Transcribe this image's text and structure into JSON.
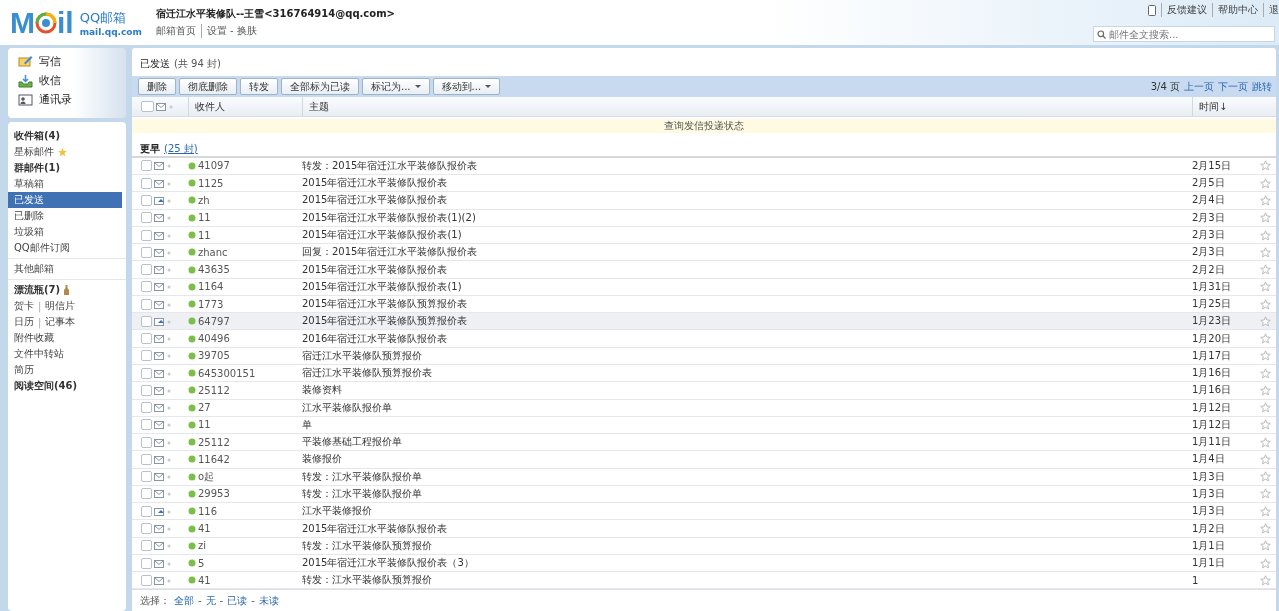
{
  "header": {
    "logo": {
      "left": "M",
      "right": "il",
      "brand": "QQ邮箱",
      "domain": "mail.qq.com"
    },
    "account": "宿迁江水平装修队--王雪<316764914@qq.com>",
    "account_links": [
      "邮箱首页",
      "设置 - 换肤"
    ],
    "top_links": [
      "反馈建议",
      "帮助中心",
      "退"
    ],
    "search": {
      "placeholder": "邮件全文搜索..."
    }
  },
  "actions": [
    {
      "label": "写信",
      "kind": "compose"
    },
    {
      "label": "收信",
      "kind": "inbox"
    },
    {
      "label": "通讯录",
      "kind": "contacts"
    }
  ],
  "folder_groups": [
    [
      {
        "label": "收件箱(4)",
        "bold": true,
        "selected": false
      },
      {
        "label": "星标邮件",
        "bold": false,
        "selected": false,
        "kind": "star"
      },
      {
        "label": "群邮件(1)",
        "bold": true,
        "selected": false
      },
      {
        "label": "草稿箱",
        "bold": false,
        "selected": false
      },
      {
        "label": "已发送",
        "bold": false,
        "selected": true
      },
      {
        "label": "已删除",
        "bold": false,
        "selected": false
      },
      {
        "label": "垃圾箱",
        "bold": false,
        "selected": false
      },
      {
        "label": "QQ邮件订阅",
        "bold": false,
        "selected": false
      }
    ],
    [
      {
        "label": "其他邮箱",
        "bold": false,
        "selected": false
      }
    ],
    [
      {
        "label": "漂流瓶(7)",
        "bold": true,
        "selected": false,
        "kind": "bottle"
      },
      {
        "labels": [
          "贺卡",
          "明信片"
        ],
        "separator": "|",
        "bold": false,
        "selected": false
      },
      {
        "labels": [
          "日历",
          "记事本"
        ],
        "separator": "|",
        "bold": false,
        "selected": false
      },
      {
        "label": "附件收藏",
        "bold": false,
        "selected": false
      },
      {
        "label": "文件中转站",
        "bold": false,
        "selected": false
      },
      {
        "label": "简历",
        "bold": false,
        "selected": false
      },
      {
        "label": "阅读空间(46)",
        "bold": true,
        "selected": false
      }
    ]
  ],
  "mailbox": {
    "title": "已发送",
    "count": "(共 94 封)",
    "toolbar": [
      {
        "label": "删除",
        "dropdown": false
      },
      {
        "label": "彻底删除",
        "dropdown": false
      },
      {
        "label": "转发",
        "dropdown": false
      },
      {
        "label": "全部标为已读",
        "dropdown": false
      },
      {
        "label": "标记为...",
        "dropdown": true
      },
      {
        "label": "移动到...",
        "dropdown": true
      }
    ],
    "pager": {
      "page": "3/4 页",
      "links": [
        "上一页",
        "下一页",
        "跳转"
      ]
    },
    "select_all": {
      "checked": false
    },
    "columns": [
      "收件人",
      "主题",
      "时间↓"
    ],
    "notice": "查询发信投递状态",
    "group": {
      "label": "更早",
      "count": "(25 封)"
    },
    "rows": [
      {
        "recipient": "41097",
        "subject": "转发：2015年宿迁江水平装修队报价表",
        "date": "2月15日",
        "replied": false,
        "highlighted": false,
        "checked": false,
        "starred": false
      },
      {
        "recipient": "1125",
        "subject": "2015年宿迁江水平装修队报价表",
        "date": "2月5日",
        "replied": false,
        "highlighted": false,
        "checked": false,
        "starred": false
      },
      {
        "recipient": "zh",
        "subject": "2015年宿迁江水平装修队报价表",
        "date": "2月4日",
        "replied": true,
        "highlighted": false,
        "checked": false,
        "starred": false
      },
      {
        "recipient": "11",
        "subject": "2015年宿迁江水平装修队报价表(1)(2)",
        "date": "2月3日",
        "replied": false,
        "highlighted": false,
        "checked": false,
        "starred": false
      },
      {
        "recipient": "11",
        "subject": "2015年宿迁江水平装修队报价表(1)",
        "date": "2月3日",
        "replied": false,
        "highlighted": false,
        "checked": false,
        "starred": false
      },
      {
        "recipient": "zhanc",
        "subject": "回复：2015年宿迁江水平装修队报价表",
        "date": "2月3日",
        "replied": false,
        "highlighted": false,
        "checked": false,
        "starred": false
      },
      {
        "recipient": "43635",
        "subject": "2015年宿迁江水平装修队报价表",
        "date": "2月2日",
        "replied": false,
        "highlighted": false,
        "checked": false,
        "starred": false
      },
      {
        "recipient": "1164",
        "subject": "2015年宿迁江水平装修队报价表(1)",
        "date": "1月31日",
        "replied": false,
        "highlighted": false,
        "checked": false,
        "starred": false
      },
      {
        "recipient": "1773",
        "subject": "2015年宿迁江水平装修队预算报价表",
        "date": "1月25日",
        "replied": false,
        "highlighted": false,
        "checked": false,
        "starred": false
      },
      {
        "recipient": "64797",
        "subject": "2015年宿迁江水平装修队预算报价表",
        "date": "1月23日",
        "replied": true,
        "highlighted": true,
        "checked": false,
        "starred": false
      },
      {
        "recipient": "40496",
        "subject": "2016年宿迁江水平装修队报价表",
        "date": "1月20日",
        "replied": false,
        "highlighted": false,
        "checked": false,
        "starred": false
      },
      {
        "recipient": "39705",
        "subject": "宿迁江水平装修队预算报价",
        "date": "1月17日",
        "replied": false,
        "highlighted": false,
        "checked": false,
        "starred": false
      },
      {
        "recipient": "645300151",
        "subject": "宿迁江水平装修队预算报价表",
        "date": "1月16日",
        "replied": false,
        "highlighted": false,
        "checked": false,
        "starred": false
      },
      {
        "recipient": "25112",
        "subject": "装修资料",
        "date": "1月16日",
        "replied": false,
        "highlighted": false,
        "checked": false,
        "starred": false
      },
      {
        "recipient": "27",
        "subject": "江水平装修队报价单",
        "date": "1月12日",
        "replied": false,
        "highlighted": false,
        "checked": false,
        "starred": false
      },
      {
        "recipient": "11",
        "subject": "单",
        "date": "1月12日",
        "replied": false,
        "highlighted": false,
        "checked": false,
        "starred": false
      },
      {
        "recipient": "25112",
        "subject": "平装修基础工程报价单",
        "date": "1月11日",
        "replied": false,
        "highlighted": false,
        "checked": false,
        "starred": false
      },
      {
        "recipient": "11642",
        "subject": "装修报价",
        "date": "1月4日",
        "replied": false,
        "highlighted": false,
        "checked": false,
        "starred": false
      },
      {
        "recipient": "o起",
        "subject": "转发：江水平装修队报价单",
        "date": "1月3日",
        "replied": false,
        "highlighted": false,
        "checked": false,
        "starred": false
      },
      {
        "recipient": "29953",
        "subject": "转发：江水平装修队报价单",
        "date": "1月3日",
        "replied": false,
        "highlighted": false,
        "checked": false,
        "starred": false
      },
      {
        "recipient": "116",
        "subject": "江水平装修报价",
        "date": "1月3日",
        "replied": true,
        "highlighted": false,
        "checked": false,
        "starred": false
      },
      {
        "recipient": "41",
        "subject": "2015年宿迁江水平装修队报价表",
        "date": "1月2日",
        "replied": false,
        "highlighted": false,
        "checked": false,
        "starred": false
      },
      {
        "recipient": "zi",
        "subject": "转发：江水平装修队预算报价",
        "date": "1月1日",
        "replied": false,
        "highlighted": false,
        "checked": false,
        "starred": false
      },
      {
        "recipient": "5",
        "subject": "2015年宿迁江水平装修队报价表（3）",
        "date": "1月1日",
        "replied": false,
        "highlighted": false,
        "checked": false,
        "starred": false
      },
      {
        "recipient": "41",
        "subject": "转发：江水平装修队预算报价",
        "date": "1",
        "replied": false,
        "highlighted": false,
        "checked": false,
        "starred": false
      }
    ],
    "footer": {
      "label": "选择：",
      "separator": "-",
      "links": [
        "全部",
        "无",
        "已读",
        "未读"
      ]
    }
  }
}
